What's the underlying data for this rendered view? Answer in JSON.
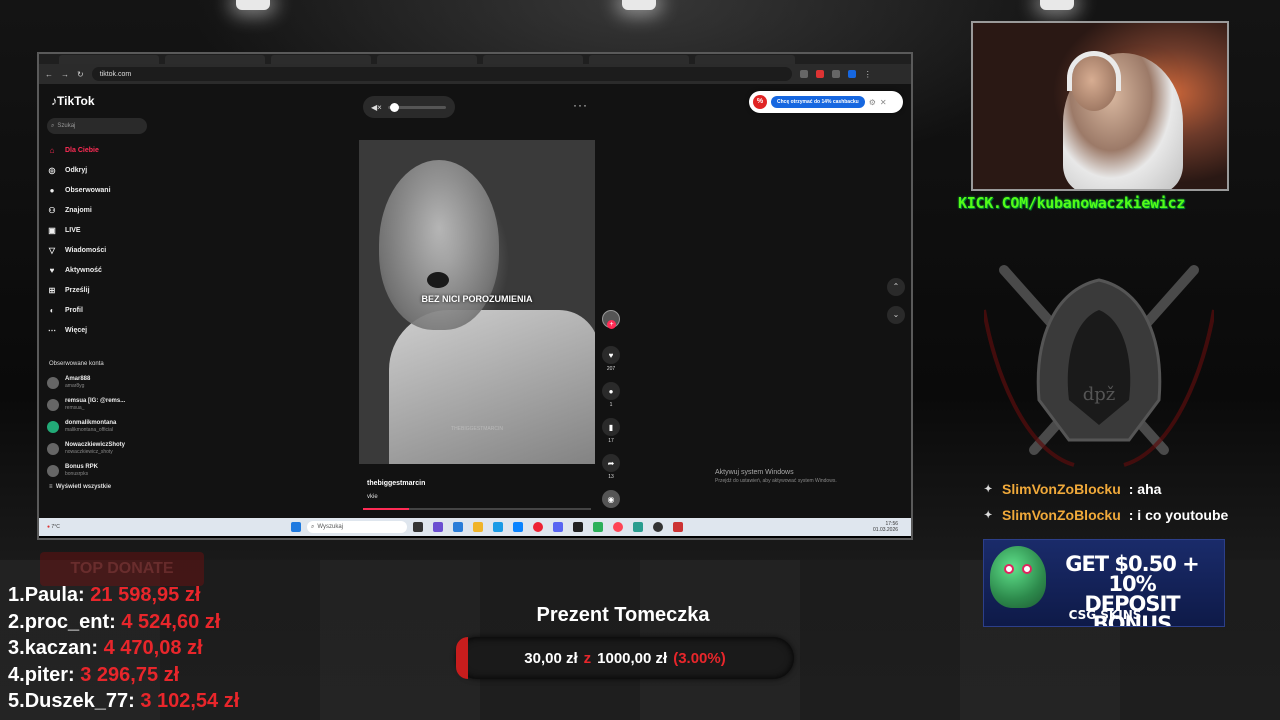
{
  "browser": {
    "url": "tiktok.com"
  },
  "tiktok": {
    "logo": "TikTok",
    "search_placeholder": "Szukaj",
    "nav": [
      {
        "label": "Dla Ciebie",
        "icon": "home-icon",
        "active": true
      },
      {
        "label": "Odkryj",
        "icon": "compass-icon"
      },
      {
        "label": "Obserwowani",
        "icon": "following-avatar-icon"
      },
      {
        "label": "Znajomi",
        "icon": "friends-icon"
      },
      {
        "label": "LIVE",
        "icon": "live-icon"
      },
      {
        "label": "Wiadomości",
        "icon": "messages-icon"
      },
      {
        "label": "Aktywność",
        "icon": "activity-icon"
      },
      {
        "label": "Prześlij",
        "icon": "upload-icon"
      },
      {
        "label": "Profil",
        "icon": "profile-icon"
      },
      {
        "label": "Więcej",
        "icon": "more-icon"
      }
    ],
    "followed_title": "Obserwowane konta",
    "followed": [
      {
        "name": "Amar888",
        "handle": "amar8yg"
      },
      {
        "name": "remsua [IG: @rems...",
        "handle": "remsua_"
      },
      {
        "name": "donmalikmontana",
        "handle": "malikmontana_official"
      },
      {
        "name": "NowaczkiewiczShoty",
        "handle": "nowaczkiewicz_shoty"
      },
      {
        "name": "Bonus RPK",
        "handle": "bonusrpks"
      }
    ],
    "show_all": "Wyświetl wszystkie",
    "video": {
      "caption": "BEZ NICI POROZUMIENIA",
      "watermark": "THEBIGGESTMARCIN",
      "author": "thebiggestmarcin",
      "description": "vkie",
      "progress": 0.2
    },
    "actions": {
      "likes": "207",
      "comments": "1",
      "saves": "17",
      "shares": "13"
    },
    "cashback": {
      "button": "Chcę otrzymać do 14% cashbacku"
    },
    "windows_activate": {
      "title": "Aktywuj system Windows",
      "subtitle": "Przejdź do ustawień, aby aktywować system Windows."
    }
  },
  "taskbar": {
    "weather": "7°C",
    "search": "Wyszukaj",
    "time": "17:56",
    "date": "01.03.2026"
  },
  "kick_url": "KICK.COM/kubanowaczkiewicz",
  "chat": [
    {
      "user": "SlimVonZoBlocku",
      "message": ": aha"
    },
    {
      "user": "SlimVonZoBlocku",
      "message": ": i co youtoube"
    }
  ],
  "ad": {
    "headline_1": "GET $0.50 + 10%",
    "headline_2": "DEPOSIT BONUS",
    "brand": "CSG SKINS"
  },
  "donations": {
    "badge": "TOP DONATE",
    "rows": [
      {
        "rank": "1.",
        "name": "Paula:",
        "amount": "21 598,95 zł"
      },
      {
        "rank": "2.",
        "name": "proc_ent:",
        "amount": "4 524,60 zł"
      },
      {
        "rank": "3.",
        "name": "kaczan:",
        "amount": "4 470,08 zł"
      },
      {
        "rank": "4.",
        "name": "piter:",
        "amount": "3 296,75 zł"
      },
      {
        "rank": "5.",
        "name": "Duszek_77:",
        "amount": "3 102,54 zł"
      }
    ]
  },
  "goal": {
    "title": "Prezent Tomeczka",
    "current": "30,00 zł",
    "sep": "z",
    "target": "1000,00 zł",
    "percent": "(3.00%)",
    "fraction": 0.03
  },
  "colors": {
    "kick_green": "#53fc18",
    "tiktok_red": "#fe2c55",
    "donate_red": "#e8262b",
    "chat_user": "#f0a93a"
  }
}
